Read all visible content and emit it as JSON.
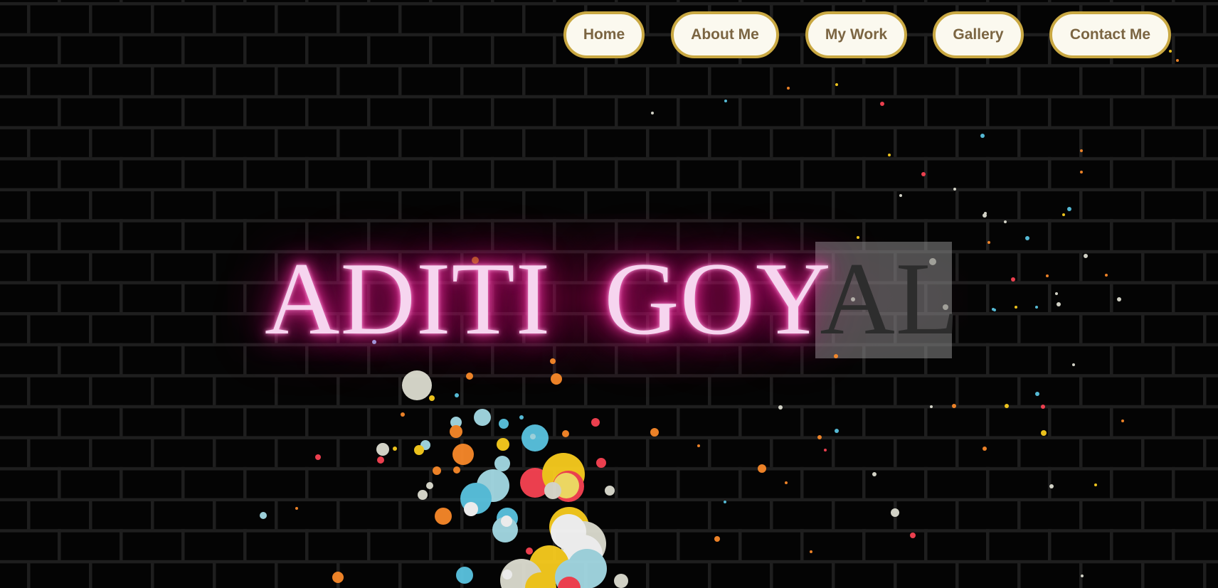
{
  "nav": {
    "items": [
      {
        "label": "Home"
      },
      {
        "label": "About Me"
      },
      {
        "label": "My Work"
      },
      {
        "label": "Gallery"
      },
      {
        "label": "Contact Me"
      }
    ]
  },
  "hero": {
    "name_main": "ADITI  GOY",
    "name_selected": "AL"
  },
  "colors": {
    "nav_border": "#c9a842",
    "nav_text": "#7b6542",
    "neon_pink": "#ff1a9c",
    "particle_palette": [
      "#ff4455",
      "#ff8c2a",
      "#ffd21f",
      "#5cc9e6",
      "#e3e3d6"
    ]
  }
}
